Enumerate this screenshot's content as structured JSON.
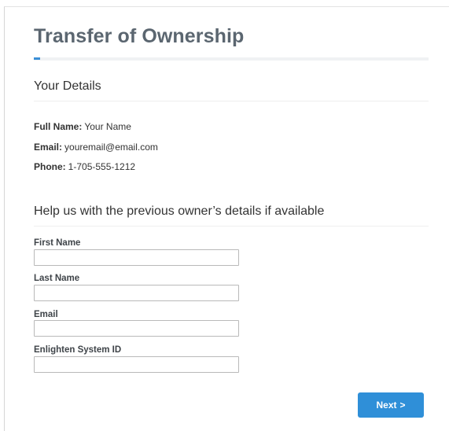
{
  "page": {
    "title": "Transfer of Ownership"
  },
  "your_details": {
    "heading": "Your Details",
    "full_name_label": "Full Name:",
    "full_name_value": "Your Name",
    "email_label": "Email:",
    "email_value": "youremail@email.com",
    "phone_label": "Phone:",
    "phone_value": "1-705-555-1212"
  },
  "previous_owner": {
    "heading": "Help us with the previous owner’s details if available",
    "fields": [
      {
        "label": "First Name",
        "value": ""
      },
      {
        "label": "Last Name",
        "value": ""
      },
      {
        "label": "Email",
        "value": ""
      },
      {
        "label": "Enlighten System ID",
        "value": ""
      }
    ]
  },
  "actions": {
    "next_label": "Next",
    "next_icon": "chevron-right-icon",
    "next_glyph": ">"
  },
  "colors": {
    "accent": "#2f8fd8",
    "title": "#5b6670"
  }
}
